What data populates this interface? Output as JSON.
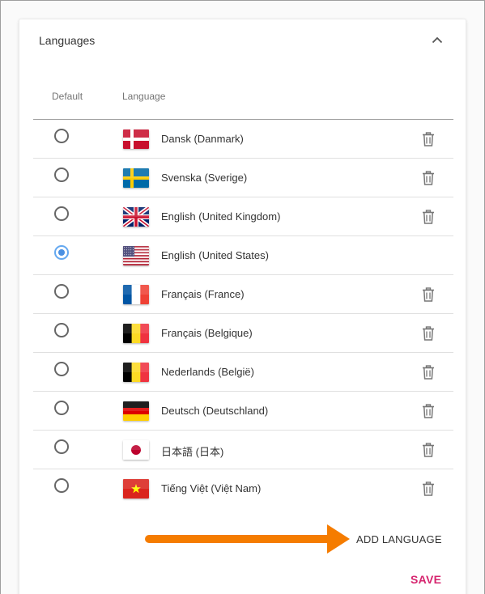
{
  "panel": {
    "title": "Languages",
    "collapse_icon": "chevron-up-icon"
  },
  "columns": {
    "default": "Default",
    "language": "Language"
  },
  "languages": [
    {
      "label": "Dansk (Danmark)",
      "flag": "dk",
      "default": false,
      "deletable": true
    },
    {
      "label": "Svenska (Sverige)",
      "flag": "se",
      "default": false,
      "deletable": true
    },
    {
      "label": "English (United Kingdom)",
      "flag": "gb",
      "default": false,
      "deletable": true
    },
    {
      "label": "English (United States)",
      "flag": "us",
      "default": true,
      "deletable": false
    },
    {
      "label": "Français (France)",
      "flag": "fr",
      "default": false,
      "deletable": true
    },
    {
      "label": "Français (Belgique)",
      "flag": "be",
      "default": false,
      "deletable": true
    },
    {
      "label": "Nederlands (België)",
      "flag": "be",
      "default": false,
      "deletable": true
    },
    {
      "label": "Deutsch (Deutschland)",
      "flag": "de",
      "default": false,
      "deletable": true
    },
    {
      "label": "日本語 (日本)",
      "flag": "jp",
      "default": false,
      "deletable": true
    },
    {
      "label": "Tiếng Việt (Việt Nam)",
      "flag": "vn",
      "default": false,
      "deletable": true
    }
  ],
  "actions": {
    "add_language": "ADD LANGUAGE",
    "save": "SAVE"
  },
  "colors": {
    "accent": "#d6246e",
    "radio_selected": "#4a90e2",
    "arrow": "#f57c00"
  }
}
